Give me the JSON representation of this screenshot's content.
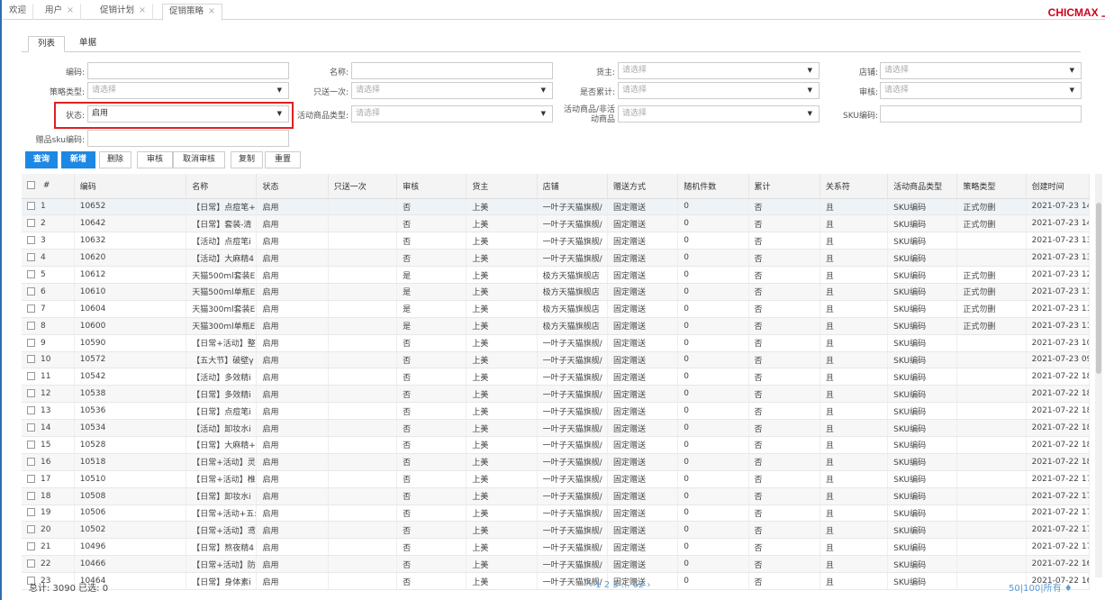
{
  "top_tabs": [
    {
      "label": "欢迎",
      "closable": false
    },
    {
      "label": "用户",
      "closable": true
    },
    {
      "label": "促销计划",
      "closable": true
    },
    {
      "label": "促销策略",
      "closable": true,
      "active": true
    }
  ],
  "close_glyph": "×",
  "brand": "CHICMAX 上",
  "sub_tabs": [
    "列表",
    "单据"
  ],
  "form": {
    "code_label": "编码:",
    "name_label": "名称:",
    "owner_label": "货主:",
    "owner_placeholder": "请选择",
    "store_label": "店铺:",
    "store_placeholder": "请选择",
    "strategy_type_label": "策略类型:",
    "strategy_type_placeholder": "请选择",
    "once_label": "只送一次:",
    "once_placeholder": "请选择",
    "cumulative_label": "是否累计:",
    "cumulative_placeholder": "请选择",
    "audit_label": "审核:",
    "audit_placeholder": "请选择",
    "status_label": "状态:",
    "status_value": "启用",
    "goods_type_label": "活动商品类型:",
    "goods_type_placeholder": "请选择",
    "active_goods_label_1": "活动商品/非活",
    "active_goods_label_2": "动商品",
    "active_goods_placeholder": "请选择",
    "sku_label": "SKU编码:",
    "gift_sku_label": "赠品sku编码:"
  },
  "buttons": {
    "query": "查询",
    "add": "新增",
    "delete": "删除",
    "audit": "审核",
    "cancel_audit": "取消审核",
    "copy": "复制",
    "reset": "重置"
  },
  "columns": [
    "#",
    "编码",
    "名称",
    "状态",
    "只送一次",
    "审核",
    "货主",
    "店铺",
    "赠送方式",
    "随机件数",
    "累计",
    "关系符",
    "活动商品类型",
    "策略类型",
    "创建时间"
  ],
  "rows": [
    [
      "1",
      "10652",
      "【日常】点痘笔+",
      "启用",
      "",
      "否",
      "上美",
      "一叶子天猫旗舰/",
      "固定赠送",
      "0",
      "否",
      "且",
      "SKU编码",
      "正式勿删",
      "2021-07-23 14"
    ],
    [
      "2",
      "10642",
      "【日常】套装-清",
      "启用",
      "",
      "否",
      "上美",
      "一叶子天猫旗舰/",
      "固定赠送",
      "0",
      "否",
      "且",
      "SKU编码",
      "正式勿删",
      "2021-07-23 14"
    ],
    [
      "3",
      "10632",
      "【活动】点痘笔i",
      "启用",
      "",
      "否",
      "上美",
      "一叶子天猫旗舰/",
      "固定赠送",
      "0",
      "否",
      "且",
      "SKU编码",
      "",
      "2021-07-23 13"
    ],
    [
      "4",
      "10620",
      "【活动】大麻精4",
      "启用",
      "",
      "否",
      "上美",
      "一叶子天猫旗舰/",
      "固定赠送",
      "0",
      "否",
      "且",
      "SKU编码",
      "",
      "2021-07-23 13"
    ],
    [
      "5",
      "10612",
      "天猫500ml套装E",
      "启用",
      "",
      "是",
      "上美",
      "极方天猫旗舰店",
      "固定赠送",
      "0",
      "否",
      "且",
      "SKU编码",
      "正式勿删",
      "2021-07-23 12"
    ],
    [
      "6",
      "10610",
      "天猫500ml单瓶E",
      "启用",
      "",
      "是",
      "上美",
      "极方天猫旗舰店",
      "固定赠送",
      "0",
      "否",
      "且",
      "SKU编码",
      "正式勿删",
      "2021-07-23 11"
    ],
    [
      "7",
      "10604",
      "天猫300ml套装E",
      "启用",
      "",
      "是",
      "上美",
      "极方天猫旗舰店",
      "固定赠送",
      "0",
      "否",
      "且",
      "SKU编码",
      "正式勿删",
      "2021-07-23 11"
    ],
    [
      "8",
      "10600",
      "天猫300ml单瓶E",
      "启用",
      "",
      "是",
      "上美",
      "极方天猫旗舰店",
      "固定赠送",
      "0",
      "否",
      "且",
      "SKU编码",
      "正式勿删",
      "2021-07-23 11"
    ],
    [
      "9",
      "10590",
      "【日常+活动】整",
      "启用",
      "",
      "否",
      "上美",
      "一叶子天猫旗舰/",
      "固定赠送",
      "0",
      "否",
      "且",
      "SKU编码",
      "",
      "2021-07-23 10"
    ],
    [
      "10",
      "10572",
      "【五大节】破壁γ",
      "启用",
      "",
      "否",
      "上美",
      "一叶子天猫旗舰/",
      "固定赠送",
      "0",
      "否",
      "且",
      "SKU编码",
      "",
      "2021-07-23 09"
    ],
    [
      "11",
      "10542",
      "【活动】多效精i",
      "启用",
      "",
      "否",
      "上美",
      "一叶子天猫旗舰/",
      "固定赠送",
      "0",
      "否",
      "且",
      "SKU编码",
      "",
      "2021-07-22 18"
    ],
    [
      "12",
      "10538",
      "【日常】多效精i",
      "启用",
      "",
      "否",
      "上美",
      "一叶子天猫旗舰/",
      "固定赠送",
      "0",
      "否",
      "且",
      "SKU编码",
      "",
      "2021-07-22 18"
    ],
    [
      "13",
      "10536",
      "【日常】点痘笔i",
      "启用",
      "",
      "否",
      "上美",
      "一叶子天猫旗舰/",
      "固定赠送",
      "0",
      "否",
      "且",
      "SKU编码",
      "",
      "2021-07-22 18"
    ],
    [
      "14",
      "10534",
      "【活动】卸妆水i",
      "启用",
      "",
      "否",
      "上美",
      "一叶子天猫旗舰/",
      "固定赠送",
      "0",
      "否",
      "且",
      "SKU编码",
      "",
      "2021-07-22 18"
    ],
    [
      "15",
      "10528",
      "【日常】大麻精+",
      "启用",
      "",
      "否",
      "上美",
      "一叶子天猫旗舰/",
      "固定赠送",
      "0",
      "否",
      "且",
      "SKU编码",
      "",
      "2021-07-22 18"
    ],
    [
      "16",
      "10518",
      "【日常+活动】灵",
      "启用",
      "",
      "否",
      "上美",
      "一叶子天猫旗舰/",
      "固定赠送",
      "0",
      "否",
      "且",
      "SKU编码",
      "",
      "2021-07-22 18"
    ],
    [
      "17",
      "10510",
      "【日常+活动】椎",
      "启用",
      "",
      "否",
      "上美",
      "一叶子天猫旗舰/",
      "固定赠送",
      "0",
      "否",
      "且",
      "SKU编码",
      "",
      "2021-07-22 17"
    ],
    [
      "18",
      "10508",
      "【日常】卸妆水i",
      "启用",
      "",
      "否",
      "上美",
      "一叶子天猫旗舰/",
      "固定赠送",
      "0",
      "否",
      "且",
      "SKU编码",
      "",
      "2021-07-22 17"
    ],
    [
      "19",
      "10506",
      "【日常+活动+五:",
      "启用",
      "",
      "否",
      "上美",
      "一叶子天猫旗舰/",
      "固定赠送",
      "0",
      "否",
      "且",
      "SKU编码",
      "",
      "2021-07-22 17"
    ],
    [
      "20",
      "10502",
      "【日常+活动】鸢",
      "启用",
      "",
      "否",
      "上美",
      "一叶子天猫旗舰/",
      "固定赠送",
      "0",
      "否",
      "且",
      "SKU编码",
      "",
      "2021-07-22 17"
    ],
    [
      "21",
      "10496",
      "【日常】熬夜精4",
      "启用",
      "",
      "否",
      "上美",
      "一叶子天猫旗舰/",
      "固定赠送",
      "0",
      "否",
      "且",
      "SKU编码",
      "",
      "2021-07-22 17"
    ],
    [
      "22",
      "10466",
      "【日常+活动】防",
      "启用",
      "",
      "否",
      "上美",
      "一叶子天猫旗舰/",
      "固定赠送",
      "0",
      "否",
      "且",
      "SKU编码",
      "",
      "2021-07-22 16"
    ],
    [
      "23",
      "10464",
      "【日常】身体素i",
      "启用",
      "",
      "否",
      "上美",
      "一叶子天猫旗舰/",
      "固定赠送",
      "0",
      "否",
      "且",
      "SKU编码",
      "",
      "2021-07-22 16"
    ]
  ],
  "footer": {
    "summary": "总计: 3090 已选: 0",
    "pager": "‹ 1 2 3 ... 62 ›",
    "page_size_50": "50",
    "page_size_100": "100",
    "page_size_all": "所有",
    "sep": "|",
    "pin": "♦"
  }
}
